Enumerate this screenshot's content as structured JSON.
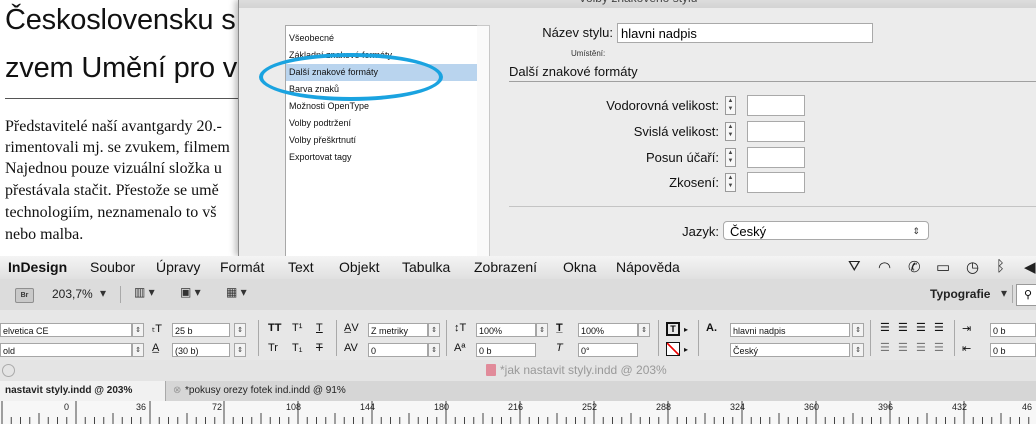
{
  "document": {
    "headline_lines": [
      "Československu s",
      "zvem Umění pro v"
    ],
    "body_lines": [
      "Představitelé naší avantgardy 20.-",
      "rimentovali mj. se zvukem, filmem",
      "Najednou pouze vizuální složka u",
      "přestávala stačit. Přestože se umě",
      "technologiím, neznamenalo to vš",
      "nebo malba."
    ]
  },
  "dialog": {
    "title": "Volby znakového stylu",
    "categories": [
      "Všeobecné",
      "Základní znakové formáty",
      "Další znakové formáty",
      "Barva znaků",
      "Možnosti OpenType",
      "Volby podtržení",
      "Volby přeškrtnutí",
      "Exportovat tagy"
    ],
    "selected_category": "Další znakové formáty",
    "style_name_label": "Název stylu:",
    "style_name_value": "hlavni nadpis",
    "location_label": "Umístění:",
    "section_title": "Další znakové formáty",
    "fields": {
      "horizontal_scale": "Vodorovná velikost:",
      "vertical_scale": "Svislá velikost:",
      "baseline_shift": "Posun účaří:",
      "skew": "Zkosení:"
    },
    "language_label": "Jazyk:",
    "language_value": "Český",
    "highlight_color": "#1aa3e0"
  },
  "menubar": {
    "app": "InDesign",
    "items": [
      "Soubor",
      "Úpravy",
      "Formát",
      "Text",
      "Objekt",
      "Tabulka",
      "Zobrazení",
      "Okna",
      "Nápověda"
    ]
  },
  "appbar": {
    "br_badge": "Br",
    "zoom": "203,7%",
    "workspace": "Typografie"
  },
  "control": {
    "font_family": "elvetica CE",
    "font_style": "old",
    "font_size": "25 b",
    "leading": "(30 b)",
    "kerning": "Z metriky",
    "tracking": "0",
    "vertical_scale": "100%",
    "horizontal_scale": "100%",
    "baseline_shift": "0 b",
    "skew": "0°",
    "char_style": "hlavni nadpis",
    "language": "Český",
    "indent_1": "0 b",
    "indent_2": "0 b"
  },
  "docstatus": {
    "title": "*jak nastavit styly.indd @ 203%"
  },
  "tabs": [
    {
      "label": "nastavit styly.indd @ 203%",
      "active": true
    },
    {
      "label": "*pokusy orezy fotek ind.indd @ 91%",
      "active": false
    }
  ],
  "ruler": {
    "labels": [
      "0",
      "36",
      "72",
      "108",
      "144",
      "180",
      "216",
      "252",
      "288",
      "324",
      "360",
      "396",
      "432",
      "46"
    ]
  }
}
